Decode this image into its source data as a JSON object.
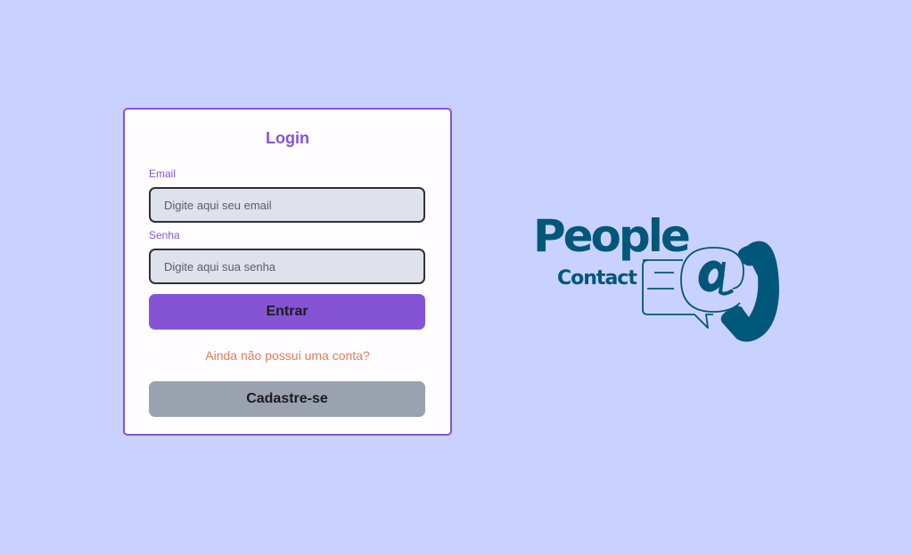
{
  "login": {
    "title": "Login",
    "email_label": "Email",
    "email_placeholder": "Digite aqui seu email",
    "email_value": "",
    "password_label": "Senha",
    "password_placeholder": "Digite aqui sua senha",
    "password_value": "",
    "submit_label": "Entrar",
    "no_account_text": "Ainda não possui uma conta?",
    "signup_label": "Cadastre-se"
  },
  "brand": {
    "logo_line1": "People",
    "logo_line2": "Contact",
    "logo_icons": [
      "chat-bubble-icon",
      "at-sign-icon",
      "phone-handset-icon"
    ]
  },
  "colors": {
    "background": "#c9d2ff",
    "accent": "#8454d5",
    "link": "#da7f5f",
    "secondary_button": "#9aa2af",
    "brand": "#00577a"
  }
}
